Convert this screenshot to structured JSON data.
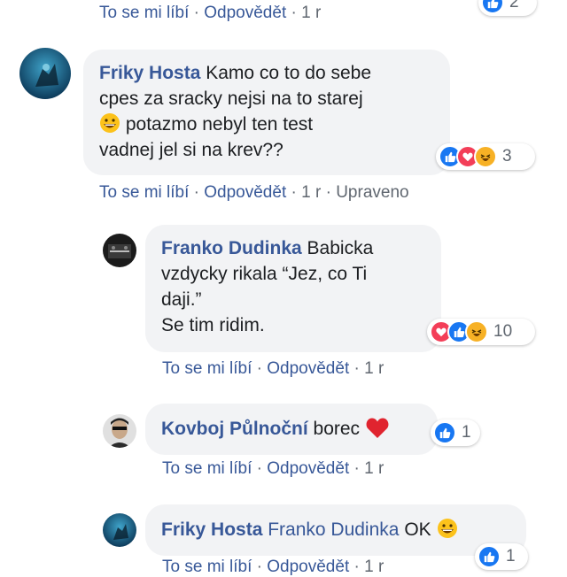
{
  "labels": {
    "like": "To se mi líbí",
    "reply": "Odpovědět",
    "dot": "·"
  },
  "top_actions": {
    "time": "1 r",
    "reaction_count": "2"
  },
  "comment1": {
    "author": "Friky Hosta",
    "line1": "Kamo co to do sebe",
    "line2": "cpes za sracky nejsi na to starej",
    "line3": "potazmo nebyl ten test",
    "line4": "vadnej jel si na krev??",
    "reaction_count": "3",
    "time": "1 r",
    "edited": "Upraveno"
  },
  "reply1": {
    "author": "Franko Dudinka",
    "line1": "Babicka",
    "line2": "vzdycky rikala “Jez, co Ti",
    "line3": "daji.”",
    "line4": "Se tim ridim.",
    "reaction_count": "10",
    "time": "1 r"
  },
  "reply2": {
    "author": "Kovboj Půlnoční",
    "text": "borec",
    "reaction_count": "1",
    "time": "1 r"
  },
  "reply3": {
    "author": "Friky Hosta",
    "mention": "Franko Dudinka",
    "text": "OK",
    "reaction_count": "1",
    "time": "1 r"
  },
  "colors": {
    "link": "#385898",
    "bubble": "#f2f3f5",
    "like": "#1877f2",
    "love": "#f33e58",
    "haha": "#f7b125"
  }
}
